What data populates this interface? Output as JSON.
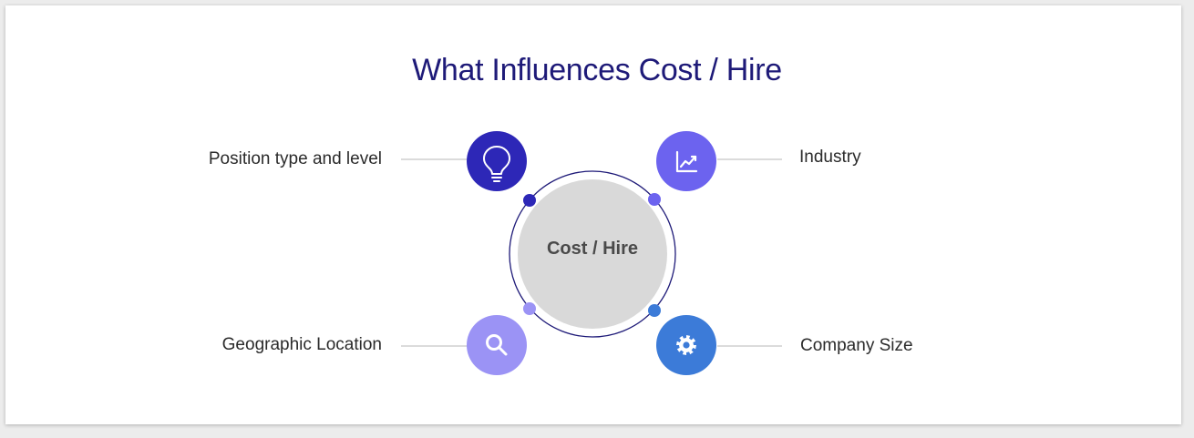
{
  "diagram": {
    "title": "What Influences Cost / Hire",
    "center_label": "Cost / Hire",
    "factors": [
      {
        "label": "Position type and level",
        "icon": "lightbulb-icon",
        "color": "#2d27b7"
      },
      {
        "label": "Industry",
        "icon": "trending-chart-icon",
        "color": "#6c63ef"
      },
      {
        "label": "Geographic Location",
        "icon": "search-icon",
        "color": "#9b93f5"
      },
      {
        "label": "Company Size",
        "icon": "gear-icon",
        "color": "#3c7bd8"
      }
    ],
    "colors": {
      "title": "#1e1a78",
      "center_fill": "#d9d9d9",
      "ring": "#1e1a78",
      "connector": "#cfcfcf"
    }
  }
}
